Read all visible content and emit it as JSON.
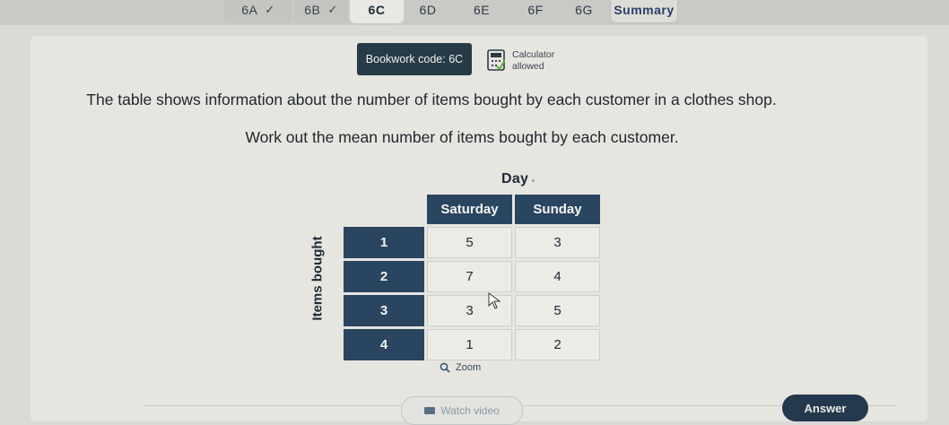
{
  "tabs": [
    {
      "label": "6A",
      "state": "done",
      "check": "✓"
    },
    {
      "label": "6B",
      "state": "done",
      "check": "✓"
    },
    {
      "label": "6C",
      "state": "active"
    },
    {
      "label": "6D",
      "state": "normal"
    },
    {
      "label": "6E",
      "state": "normal"
    },
    {
      "label": "6F",
      "state": "normal"
    },
    {
      "label": "6G",
      "state": "normal"
    },
    {
      "label": "Summary",
      "state": "summary"
    }
  ],
  "header": {
    "bookwork": "Bookwork code: 6C",
    "calculator_line1": "Calculator",
    "calculator_line2": "allowed",
    "calculator_icon": "calculator-icon"
  },
  "question": {
    "line1": "The table shows information about the number of items bought by each customer in a clothes shop.",
    "line2": "Work out the mean number of items bought by each customer."
  },
  "table": {
    "top_label": "Day",
    "side_label": "Items bought",
    "columns": [
      "Saturday",
      "Sunday"
    ],
    "rows": [
      {
        "label": "1",
        "values": [
          "5",
          "3"
        ]
      },
      {
        "label": "2",
        "values": [
          "7",
          "4"
        ]
      },
      {
        "label": "3",
        "values": [
          "3",
          "5"
        ]
      },
      {
        "label": "4",
        "values": [
          "1",
          "2"
        ]
      }
    ]
  },
  "zoom_label": "Zoom",
  "watch_video_label": "Watch video",
  "answer_label": "Answer",
  "colors": {
    "header_navy": "#2a4560",
    "button_navy": "#24394d",
    "background": "#d9d9d6"
  }
}
